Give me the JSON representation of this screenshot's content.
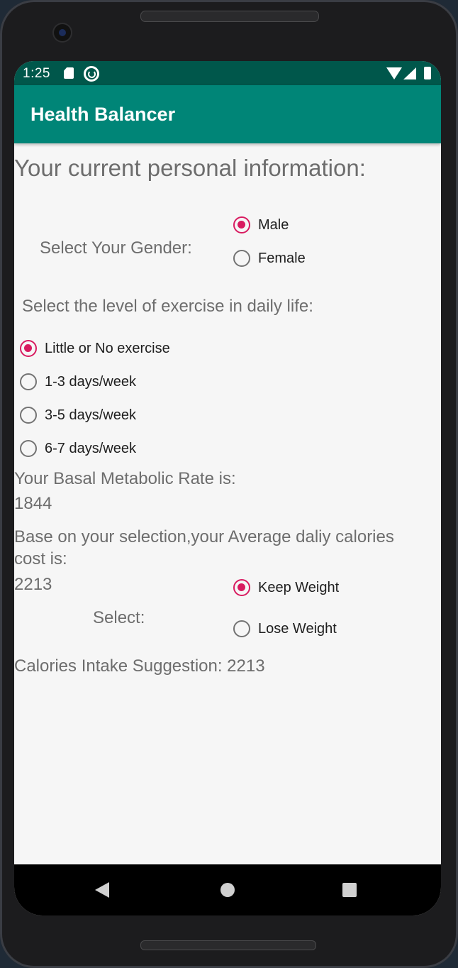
{
  "statusbar": {
    "time": "1:25"
  },
  "appbar": {
    "title": "Health Balancer"
  },
  "main": {
    "heading": "Your current personal information:",
    "gender": {
      "label": "Select Your Gender:",
      "options": [
        "Male",
        "Female"
      ],
      "selected": "Male"
    },
    "exercise": {
      "label": "Select the level of exercise in daily life:",
      "options": [
        "Little or No exercise",
        "1-3 days/week",
        "3-5 days/week",
        "6-7 days/week"
      ],
      "selected": "Little or No exercise"
    },
    "bmr": {
      "label": "Your Basal Metabolic Rate is:",
      "value": "1844"
    },
    "daily_cost": {
      "label_line1": "Base on your selection,your Average daliy calories",
      "label_line2": "cost is:",
      "value": "2213"
    },
    "goal": {
      "label": "Select:",
      "options": [
        "Keep Weight",
        "Lose Weight"
      ],
      "selected": "Keep Weight"
    },
    "suggestion": "Calories Intake Suggestion: 2213"
  },
  "colors": {
    "statusbar": "#00574b",
    "appbar": "#008577",
    "accent": "#d81b60"
  }
}
